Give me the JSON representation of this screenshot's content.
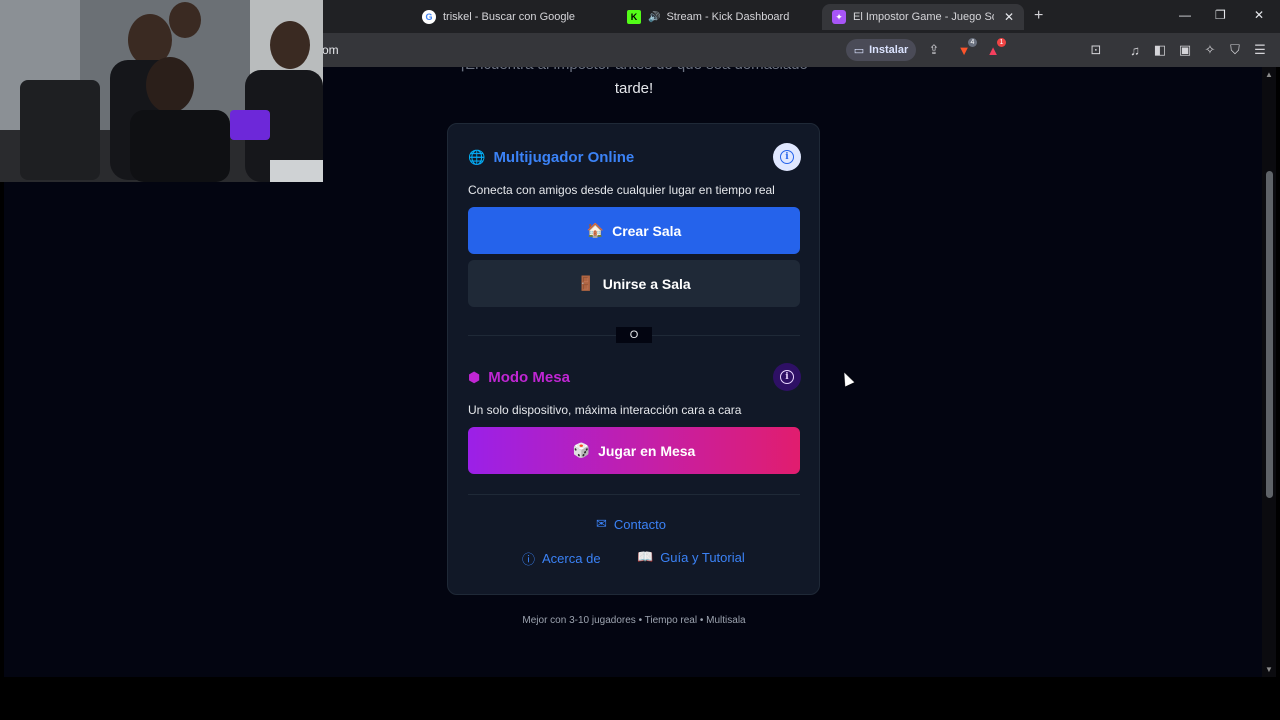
{
  "browser": {
    "tabs": [
      {
        "title": "triskel - Buscar con Google",
        "favicon": "google-icon"
      },
      {
        "title": "Stream - Kick Dashboard",
        "favicon": "kick-icon",
        "audio": "speaker-icon"
      },
      {
        "title": "El Impostor Game - Juego Social",
        "favicon": "impostor-icon",
        "active": true
      }
    ],
    "url_fragment": "om",
    "install_label": "Instalar",
    "brave_badge": "4",
    "alert_badge": "1"
  },
  "page": {
    "intro_line1": "¡Encuentra al impostor antes de que sea demasiado",
    "intro_line2": "tarde!",
    "online": {
      "icon": "🌐",
      "title": "Multijugador Online",
      "description": "Conecta con amigos desde cualquier lugar en tiempo real",
      "create_icon": "🏠",
      "create_label": "Crear Sala",
      "join_icon": "🚪",
      "join_label": "Unirse a Sala"
    },
    "separator": "O",
    "table_mode": {
      "icon": "⬢",
      "title": "Modo Mesa",
      "description": "Un solo dispositivo, máxima interacción cara a cara",
      "play_icon": "🎲",
      "play_label": "Jugar en Mesa"
    },
    "links": {
      "contact": "Contacto",
      "about": "Acerca de",
      "guide": "Guía y Tutorial"
    },
    "footer": "Mejor con 3-10 jugadores • Tiempo real • Multisala"
  },
  "colors": {
    "page_bg": "#030511",
    "card_bg": "#111827",
    "online_accent": "#3b82f6",
    "table_accent": "#c026d3",
    "primary_button": "#2563eb",
    "gradient_start": "#9b20e8",
    "gradient_end": "#e11d6e"
  }
}
